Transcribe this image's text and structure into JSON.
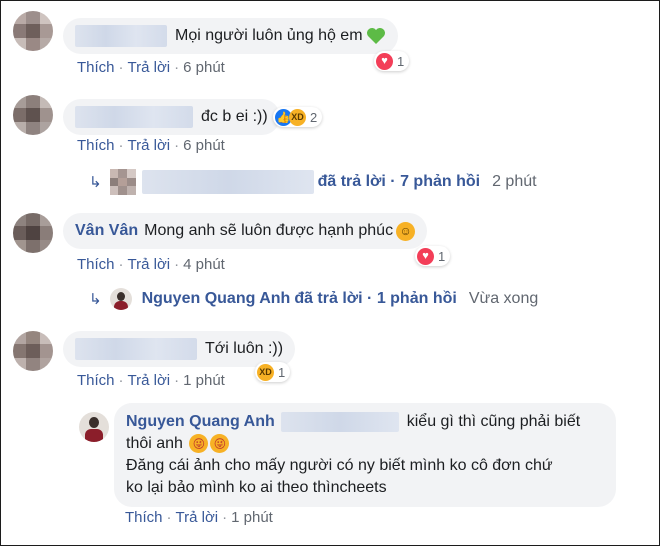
{
  "actions": {
    "like": "Thích",
    "reply": "Trả lời",
    "sep": "·"
  },
  "comments": [
    {
      "text": "Mọi người luôn ủng hộ em",
      "time": "6 phút",
      "reactions": "1"
    },
    {
      "text": "đc b ei :))",
      "time": "6 phút",
      "reactions": "2"
    },
    {
      "name": "Vân Vân",
      "text": "Mong anh sẽ luôn được hạnh phúc",
      "time": "4 phút",
      "reactions": "1"
    },
    {
      "text": "Tới luôn :))",
      "time": "1 phút",
      "reactions": "1"
    }
  ],
  "reply_summaries": [
    {
      "text": "đã trả lời · 7 phản hồi",
      "time": "2 phút"
    },
    {
      "name": "Nguyen Quang Anh",
      "text": "đã trả lời · 1 phản hồi",
      "time": "Vừa xong"
    }
  ],
  "reply": {
    "name": "Nguyen Quang Anh",
    "line1": "kiểu gì thì cũng phải biết",
    "line2": "thôi anh",
    "line3": "Đăng cái ảnh cho mấy người có ny biết mình ko cô đơn chứ",
    "line4": "ko lại bảo mình ko ai theo thìncheets",
    "time": "1 phút"
  },
  "colors": {
    "link": "#385898",
    "bubble": "#f2f3f5",
    "love": "#f33e58",
    "like": "#1877f2",
    "haha": "#f7b125"
  },
  "icons": [
    "love-icon",
    "like-icon",
    "haha-icon",
    "reply-arrow-icon",
    "green-heart-emoji",
    "smile-emoji",
    "tongue-emoji"
  ]
}
